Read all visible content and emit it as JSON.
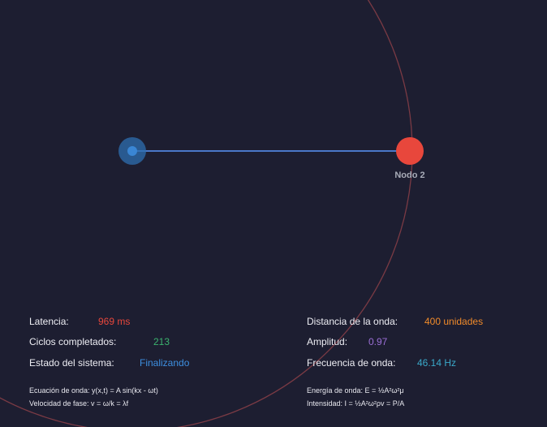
{
  "node_label": "Nodo 2",
  "colors": {
    "background": "#1d1e31",
    "node_source": "#2e6fb0",
    "node_target": "#e8473c",
    "link_line": "#4a78c8",
    "wave_ring": "#7a3a44"
  },
  "stats": {
    "latency": {
      "label": "Latencia:",
      "value": "969 ms",
      "color": "#e8473c"
    },
    "cycles": {
      "label": "Ciclos completados:",
      "value": "213",
      "color": "#3bb36e"
    },
    "status": {
      "label": "Estado del sistema:",
      "value": "Finalizando",
      "color": "#3d8fe0"
    },
    "distance": {
      "label": "Distancia de la onda:",
      "value": "400 unidades",
      "color": "#f08a2a"
    },
    "amplitude": {
      "label": "Amplitud:",
      "value": "0.97",
      "color": "#9b6fd6"
    },
    "frequency": {
      "label": "Frecuencia de onda:",
      "value": "46.14 Hz",
      "color": "#3aa9c9"
    }
  },
  "formulas": {
    "wave_equation": "Ecuación de onda: y(x,t) = A sin(kx - ωt)",
    "phase_velocity": "Velocidad de fase: v = ω/k = λf",
    "wave_energy": "Energía de onda: E = ½A²ω²μ",
    "intensity": "Intensidad: I = ½A²ω²ρv = P/A"
  }
}
